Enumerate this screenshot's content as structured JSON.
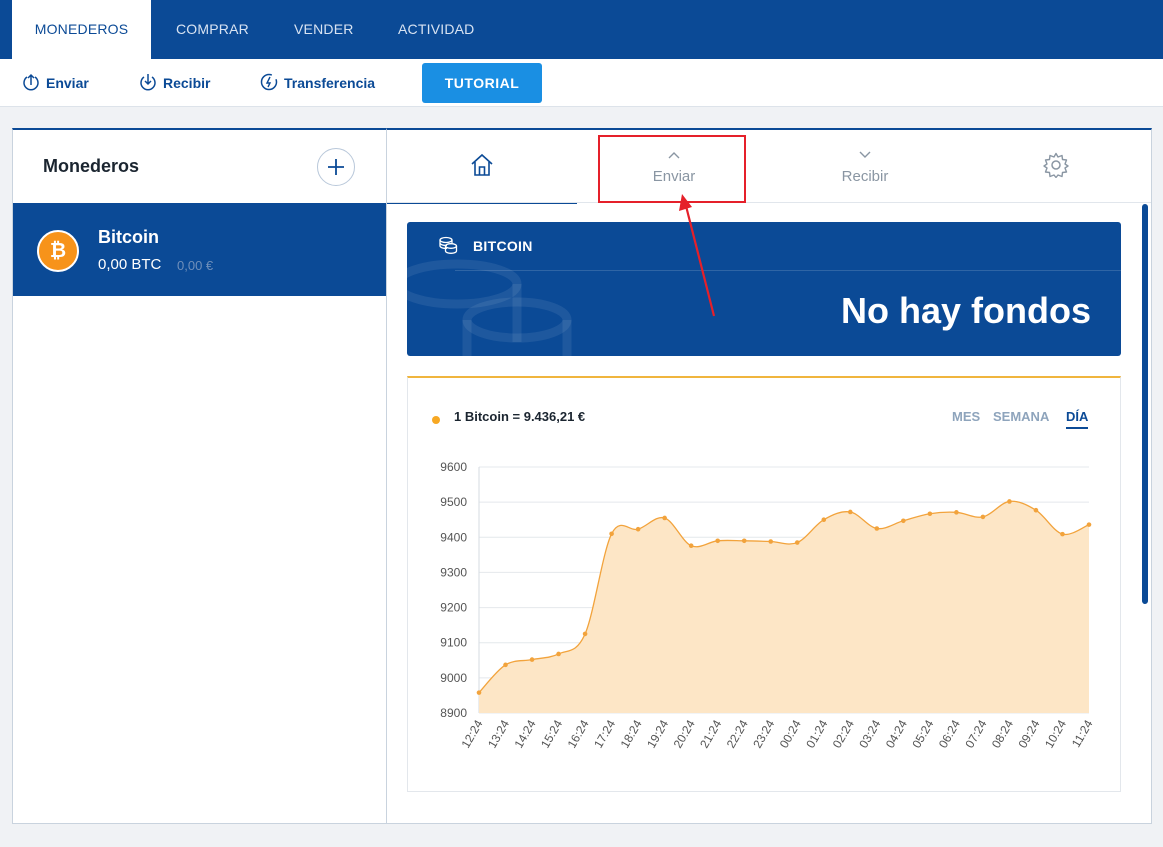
{
  "topnav": {
    "tabs": [
      {
        "label": "MONEDEROS",
        "active": true
      },
      {
        "label": "COMPRAR",
        "active": false
      },
      {
        "label": "VENDER",
        "active": false
      },
      {
        "label": "ACTIVIDAD",
        "active": false
      }
    ]
  },
  "toolbar": {
    "send_label": "Enviar",
    "receive_label": "Recibir",
    "transfer_label": "Transferencia",
    "tutorial_label": "TUTORIAL"
  },
  "wallets": {
    "title": "Monederos",
    "items": [
      {
        "name": "Bitcoin",
        "btc_balance": "0,00 BTC",
        "eur_balance": "0,00 €",
        "icon": "bitcoin-icon"
      }
    ]
  },
  "wallet_tabs": {
    "send_label": "Enviar",
    "receive_label": "Recibir"
  },
  "balance": {
    "label": "BITCOIN",
    "value": "No hay fondos"
  },
  "price": {
    "label": "1 Bitcoin = 9.436,21 €",
    "ranges": [
      "MES",
      "SEMANA",
      "DÍA"
    ],
    "active_range": "DÍA"
  },
  "colors": {
    "brand": "#0b4a96",
    "accent": "#1a8fe3",
    "bitcoin": "#f7931a",
    "chart_line": "#f2a33c",
    "chart_fill": "#fde6c6",
    "highlight": "#e5202a"
  },
  "chart_data": {
    "type": "area",
    "x": [
      "12:24",
      "13:24",
      "14:24",
      "15:24",
      "16:24",
      "17:24",
      "18:24",
      "19:24",
      "20:24",
      "21:24",
      "22:24",
      "23:24",
      "00:24",
      "01:24",
      "02:24",
      "03:24",
      "04:24",
      "05:24",
      "06:24",
      "07:24",
      "08:24",
      "09:24",
      "10:24",
      "11:24"
    ],
    "series": [
      {
        "values": [
          8958,
          9037,
          9052,
          9068,
          9125,
          9410,
          9423,
          9455,
          9376,
          9390,
          9390,
          9388,
          9385,
          9450,
          9472,
          9425,
          9447,
          9467,
          9471,
          9458,
          9502,
          9477,
          9409,
          9436
        ]
      }
    ],
    "yticks": [
      8900,
      9000,
      9100,
      9200,
      9300,
      9400,
      9500,
      9600
    ],
    "ylim": [
      8900,
      9600
    ],
    "grid": true,
    "xlabel": "",
    "ylabel": ""
  }
}
